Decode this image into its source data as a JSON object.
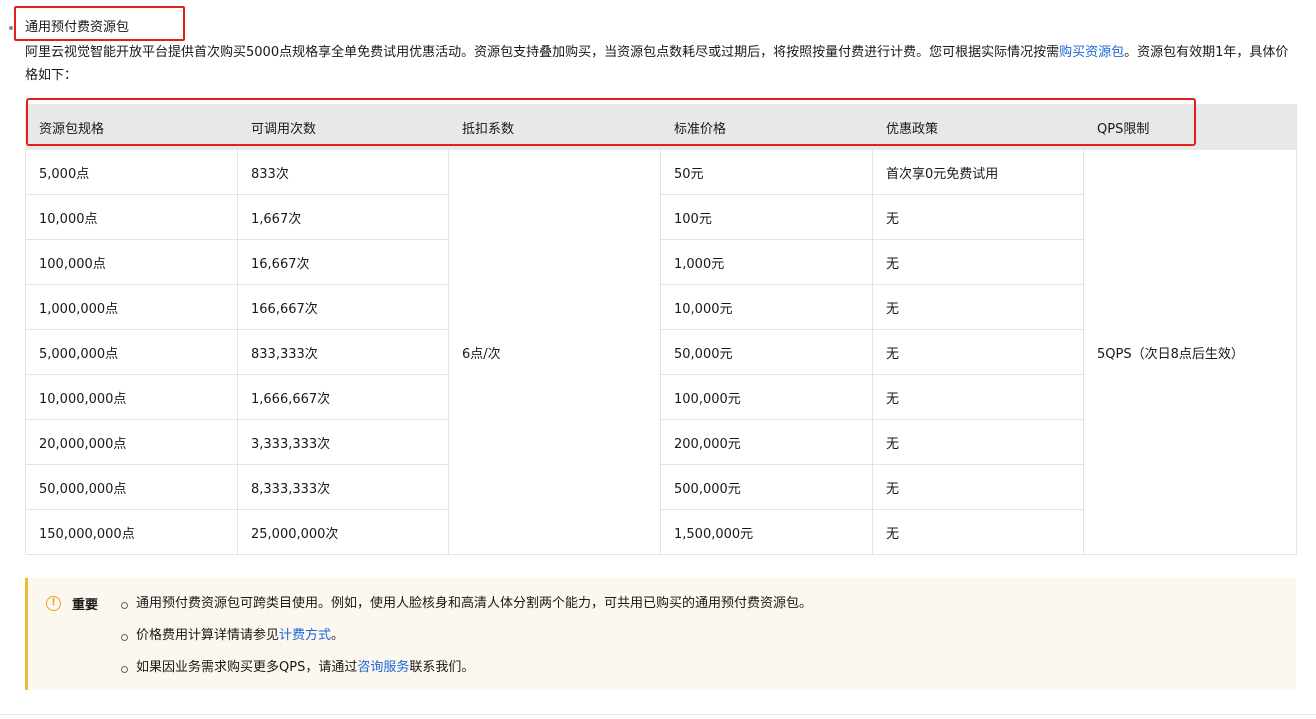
{
  "heading": "通用预付费资源包",
  "intro": {
    "text_before": "阿里云视觉智能开放平台提供首次购买5000点规格享全单免费试用优惠活动。资源包支持叠加购买，当资源包点数耗尽或过期后，将按照按量付费进行计费。您可根据实际情况按需",
    "link": "购买资源包",
    "text_after": "。资源包有效期1年，具体价格如下："
  },
  "table": {
    "headers": [
      "资源包规格",
      "可调用次数",
      "抵扣系数",
      "标准价格",
      "优惠政策",
      "QPS限制"
    ],
    "rows": [
      {
        "spec": "5,000点",
        "calls": "833次",
        "price": "50元",
        "promo": "首次享0元免费试用"
      },
      {
        "spec": "10,000点",
        "calls": "1,667次",
        "price": "100元",
        "promo": "无"
      },
      {
        "spec": "100,000点",
        "calls": "16,667次",
        "price": "1,000元",
        "promo": "无"
      },
      {
        "spec": "1,000,000点",
        "calls": "166,667次",
        "price": "10,000元",
        "promo": "无"
      },
      {
        "spec": "5,000,000点",
        "calls": "833,333次",
        "price": "50,000元",
        "promo": "无"
      },
      {
        "spec": "10,000,000点",
        "calls": "1,666,667次",
        "price": "100,000元",
        "promo": "无"
      },
      {
        "spec": "20,000,000点",
        "calls": "3,333,333次",
        "price": "200,000元",
        "promo": "无"
      },
      {
        "spec": "50,000,000点",
        "calls": "8,333,333次",
        "price": "500,000元",
        "promo": "无"
      },
      {
        "spec": "150,000,000点",
        "calls": "25,000,000次",
        "price": "1,500,000元",
        "promo": "无"
      }
    ],
    "deduction": "6点/次",
    "qps": "5QPS（次日8点后生效）"
  },
  "notice": {
    "icon": "info-icon",
    "title": "重要",
    "item1": "通用预付费资源包可跨类目使用。例如，使用人脸核身和高清人体分割两个能力，可共用已购买的通用预付费资源包。",
    "item2_before": "价格费用计算详情请参见",
    "item2_link": "计费方式",
    "item2_after": "。",
    "item3_before": "如果因业务需求购买更多QPS，请通过",
    "item3_link": "咨询服务",
    "item3_after": "联系我们。"
  },
  "colors": {
    "highlight": "#e02020",
    "link": "#1a66d6",
    "notice_bg": "#fdf8ef",
    "notice_accent": "#f0b93a"
  }
}
